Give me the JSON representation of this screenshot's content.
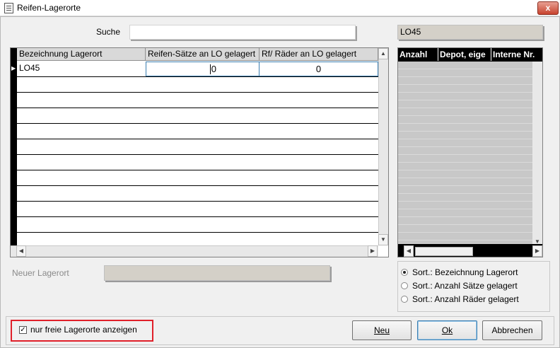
{
  "window": {
    "title": "Reifen-Lagerorte",
    "close_glyph": "x"
  },
  "search": {
    "label": "Suche",
    "value": ""
  },
  "selected_location": "LO45",
  "grid": {
    "columns": [
      "Bezeichnung Lagerort",
      "Reifen-Sätze an LO gelagert",
      "Rf/ Räder an LO gelagert"
    ],
    "rows": [
      {
        "name": "LO45",
        "sets": "0",
        "wheels": "0"
      }
    ],
    "empty_rows": 11
  },
  "detail_grid": {
    "columns": [
      "Anzahl",
      "Depot, eige",
      "Interne Nr."
    ]
  },
  "new_location": {
    "label": "Neuer Lagerort",
    "value": ""
  },
  "sort_options": [
    {
      "label": "Sort.: Bezeichnung Lagerort",
      "selected": true
    },
    {
      "label": "Sort.: Anzahl Sätze gelagert",
      "selected": false
    },
    {
      "label": "Sort.: Anzahl Räder gelagert",
      "selected": false
    }
  ],
  "filter": {
    "label": "nur freie Lagerorte anzeigen",
    "checked": true
  },
  "buttons": {
    "new": "Neu",
    "ok": "Ok",
    "cancel": "Abbrechen"
  },
  "colors": {
    "highlight": "#e0202a",
    "close": "#c7432e"
  }
}
